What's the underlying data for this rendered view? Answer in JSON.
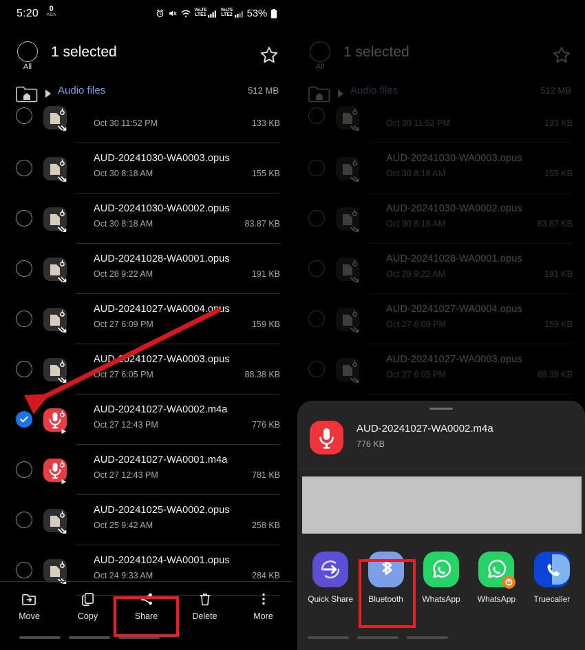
{
  "status_bar": {
    "time": "5:20",
    "data_rate_value": "0",
    "data_rate_unit": "KB/s",
    "alarm_icon": "alarm-icon",
    "mute_icon": "mute-icon",
    "wifi_icon": "wifi-icon",
    "sim1_label_top": "VoLTE",
    "sim1_label_bottom": "LTE1",
    "sim2_label_top": "VoLTE",
    "sim2_label_bottom": "LTE2",
    "battery": "53%"
  },
  "header": {
    "all_label": "All",
    "selected_title": "1 selected",
    "favorite_icon": "star-icon"
  },
  "breadcrumb": {
    "home_icon": "home-folder-icon",
    "caret_icon": "caret-right-icon",
    "path": "Audio files",
    "size": "512 MB"
  },
  "files": [
    {
      "name": "",
      "date": "Oct 30 11:52 PM",
      "size": "133 KB",
      "type": "opus",
      "selected": false,
      "clipped": true
    },
    {
      "name": "AUD-20241030-WA0003.opus",
      "date": "Oct 30 8:18 AM",
      "size": "155 KB",
      "type": "opus",
      "selected": false,
      "clipped": false
    },
    {
      "name": "AUD-20241030-WA0002.opus",
      "date": "Oct 30 8:18 AM",
      "size": "83.87 KB",
      "type": "opus",
      "selected": false,
      "clipped": false
    },
    {
      "name": "AUD-20241028-WA0001.opus",
      "date": "Oct 28 9:22 AM",
      "size": "191 KB",
      "type": "opus",
      "selected": false,
      "clipped": false
    },
    {
      "name": "AUD-20241027-WA0004.opus",
      "date": "Oct 27 6:09 PM",
      "size": "159 KB",
      "type": "opus",
      "selected": false,
      "clipped": false
    },
    {
      "name": "AUD-20241027-WA0003.opus",
      "date": "Oct 27 6:05 PM",
      "size": "88.38 KB",
      "type": "opus",
      "selected": false,
      "clipped": false
    },
    {
      "name": "AUD-20241027-WA0002.m4a",
      "date": "Oct 27 12:43 PM",
      "size": "776 KB",
      "type": "m4a",
      "selected": true,
      "clipped": false
    },
    {
      "name": "AUD-20241027-WA0001.m4a",
      "date": "Oct 27 12:43 PM",
      "size": "781 KB",
      "type": "m4a",
      "selected": false,
      "clipped": false
    },
    {
      "name": "AUD-20241025-WA0002.opus",
      "date": "Oct 25 9:42 AM",
      "size": "258 KB",
      "type": "opus",
      "selected": false,
      "clipped": false
    },
    {
      "name": "AUD-20241024-WA0001.opus",
      "date": "Oct 24 9:33 AM",
      "size": "284 KB",
      "type": "opus",
      "selected": false,
      "clipped": false
    }
  ],
  "toolbar": [
    {
      "label": "Move",
      "icon": "move-to-folder-icon"
    },
    {
      "label": "Copy",
      "icon": "copy-icon"
    },
    {
      "label": "Share",
      "icon": "share-icon"
    },
    {
      "label": "Delete",
      "icon": "trash-icon"
    },
    {
      "label": "More",
      "icon": "more-vertical-icon"
    }
  ],
  "share_sheet": {
    "handle": "drag-handle",
    "file_name": "AUD-20241027-WA0002.m4a",
    "file_size": "776 KB",
    "file_icon": "voice-recorder-icon",
    "preview_placeholder": "",
    "apps": [
      {
        "label": "Quick Share",
        "icon": "quick-share-icon",
        "color": "#5b4fd6",
        "badge": null
      },
      {
        "label": "Bluetooth",
        "icon": "bluetooth-icon",
        "color": "#7d9fe8",
        "badge": null
      },
      {
        "label": "WhatsApp",
        "icon": "whatsapp-icon",
        "color": "#25d366",
        "badge": null
      },
      {
        "label": "WhatsApp",
        "icon": "whatsapp-business-icon",
        "color": "#25d366",
        "badge": "business-badge"
      },
      {
        "label": "Truecaller",
        "icon": "truecaller-icon",
        "color": "#0b44d6",
        "badge": null
      }
    ]
  },
  "annotations": {
    "highlight_color": "#ec1c24",
    "arrow_color": "#d31920",
    "share_highlight_target": "Share",
    "bluetooth_highlight_target": "Bluetooth",
    "arrow_points_to": "selected-file-checkbox"
  }
}
